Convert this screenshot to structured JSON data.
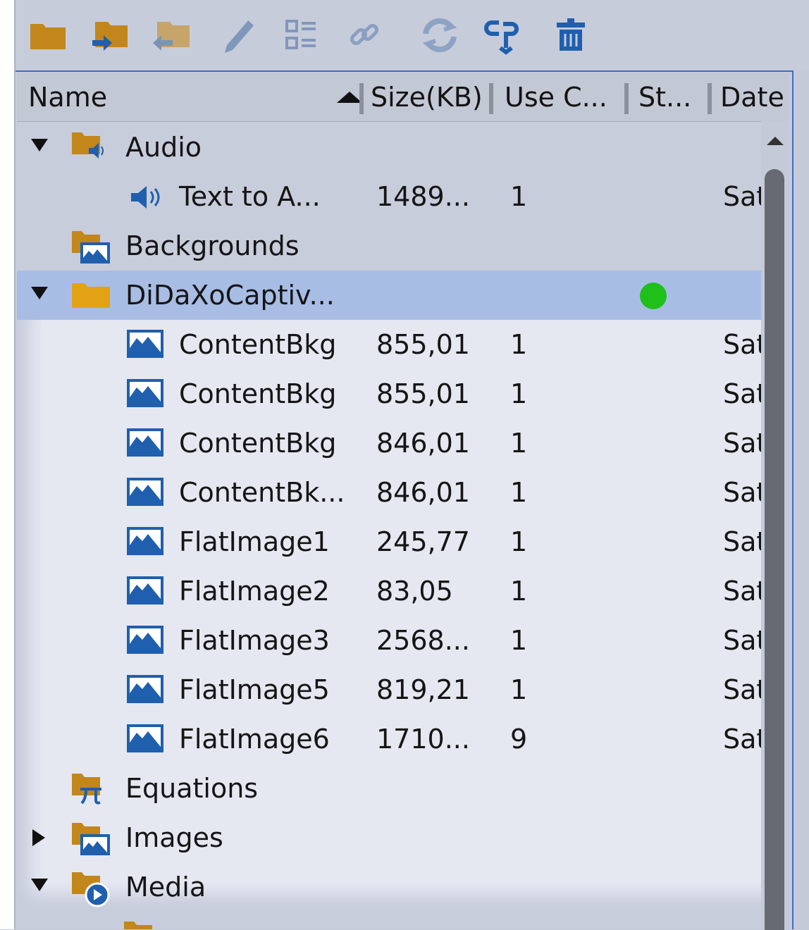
{
  "toolbar": {
    "icons": [
      "new-folder-icon",
      "import-to-folder-icon",
      "export-folder-icon",
      "rename-icon",
      "select-unused-icon",
      "link-icon",
      "update-icon",
      "swap-icon",
      "delete-icon"
    ]
  },
  "columns": {
    "name": "Name",
    "size": "Size(KB)",
    "use_count": "Use C...",
    "status": "St...",
    "date": "Date"
  },
  "rows": [
    {
      "name": "Audio",
      "size": "",
      "use": "",
      "date": "",
      "icon": "audio-folder-icon",
      "expander": "open",
      "selected": false
    },
    {
      "name": "Text to A...",
      "size": "1489...",
      "use": "1",
      "date": "Sat",
      "icon": "speaker-icon",
      "expander": "none",
      "selected": false
    },
    {
      "name": "Backgrounds",
      "size": "",
      "use": "",
      "date": "",
      "icon": "image-folder-icon",
      "expander": "none",
      "selected": false
    },
    {
      "name": "DiDaXoCaptiv...",
      "size": "",
      "use": "",
      "date": "",
      "icon": "folder-icon",
      "expander": "open",
      "selected": true,
      "status": "green"
    },
    {
      "name": "ContentBkg",
      "size": "855,01",
      "use": "1",
      "date": "Sat",
      "icon": "image-icon"
    },
    {
      "name": "ContentBkg",
      "size": "855,01",
      "use": "1",
      "date": "Sat",
      "icon": "image-icon"
    },
    {
      "name": "ContentBkg",
      "size": "846,01",
      "use": "1",
      "date": "Sat",
      "icon": "image-icon"
    },
    {
      "name": "ContentBk...",
      "size": "846,01",
      "use": "1",
      "date": "Sat",
      "icon": "image-icon"
    },
    {
      "name": "FlatImage1",
      "size": "245,77",
      "use": "1",
      "date": "Sat",
      "icon": "image-icon"
    },
    {
      "name": "FlatImage2",
      "size": "83,05",
      "use": "1",
      "date": "Sat",
      "icon": "image-icon"
    },
    {
      "name": "FlatImage3",
      "size": "2568...",
      "use": "1",
      "date": "Sat",
      "icon": "image-icon"
    },
    {
      "name": "FlatImage5",
      "size": "819,21",
      "use": "1",
      "date": "Sat",
      "icon": "image-icon"
    },
    {
      "name": "FlatImage6",
      "size": "1710...",
      "use": "9",
      "date": "Sat",
      "icon": "image-icon"
    },
    {
      "name": "Equations",
      "size": "",
      "use": "",
      "date": "",
      "icon": "equation-folder-icon",
      "expander": "none"
    },
    {
      "name": "Images",
      "size": "",
      "use": "",
      "date": "",
      "icon": "image-folder-icon",
      "expander": "closed"
    },
    {
      "name": "Media",
      "size": "",
      "use": "",
      "date": "",
      "icon": "media-folder-icon",
      "expander": "open"
    }
  ],
  "colors": {
    "folder": "#d9930a",
    "folder_dark": "#a87718",
    "icon_blue": "#1f5fae",
    "selected_row": "#a8bde4",
    "status_green": "#1fc01a"
  }
}
